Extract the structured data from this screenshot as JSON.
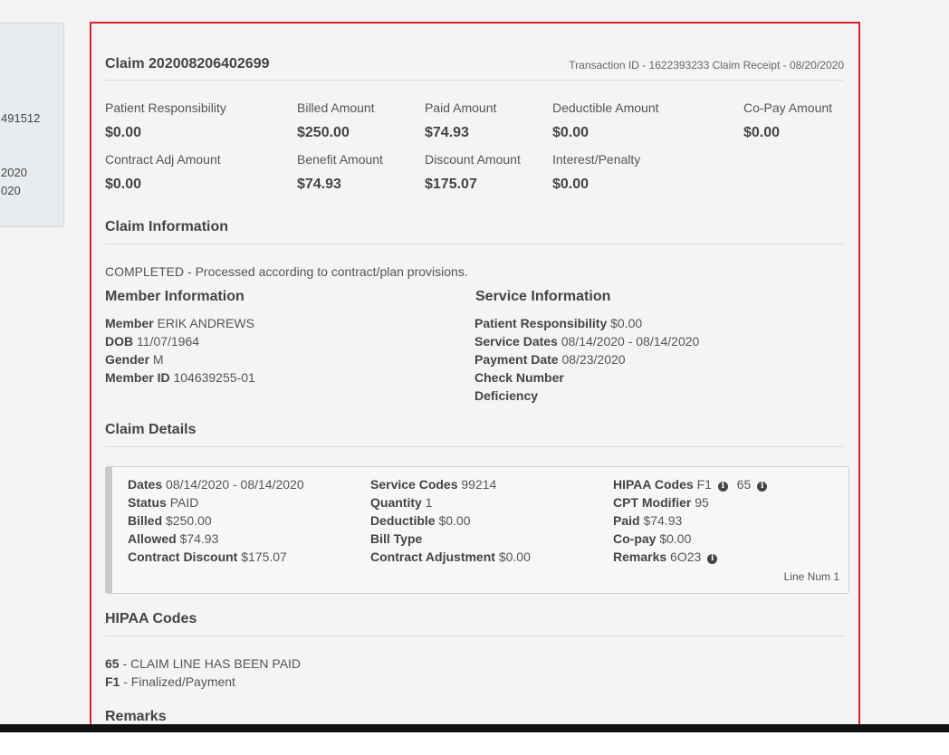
{
  "left_card": {
    "lines": [
      "491512",
      "2020",
      "020"
    ]
  },
  "claim": {
    "title": "Claim 202008206402699",
    "transaction": "Transaction ID - 1622393233 Claim Receipt - 08/20/2020"
  },
  "amounts": [
    {
      "label": "Patient Responsibility",
      "value": "$0.00"
    },
    {
      "label": "Billed Amount",
      "value": "$250.00"
    },
    {
      "label": "Paid Amount",
      "value": "$74.93"
    },
    {
      "label": "Deductible Amount",
      "value": "$0.00"
    },
    {
      "label": "Co-Pay Amount",
      "value": "$0.00"
    },
    {
      "label": "Contract Adj Amount",
      "value": "$0.00"
    },
    {
      "label": "Benefit Amount",
      "value": "$74.93"
    },
    {
      "label": "Discount Amount",
      "value": "$175.07"
    },
    {
      "label": "Interest/Penalty",
      "value": "$0.00"
    }
  ],
  "claim_information": {
    "heading": "Claim Information",
    "status_text": "COMPLETED - Processed according to contract/plan provisions."
  },
  "member": {
    "heading": "Member Information",
    "rows": [
      {
        "label": "Member",
        "value": "ERIK ANDREWS"
      },
      {
        "label": "DOB",
        "value": "11/07/1964"
      },
      {
        "label": "Gender",
        "value": "M"
      },
      {
        "label": "Member ID",
        "value": "104639255-01"
      }
    ]
  },
  "service": {
    "heading": "Service Information",
    "rows": [
      {
        "label": "Patient Responsibility",
        "value": "$0.00"
      },
      {
        "label": "Service Dates",
        "value": "08/14/2020 - 08/14/2020"
      },
      {
        "label": "Payment Date",
        "value": "08/23/2020"
      },
      {
        "label": "Check Number",
        "value": ""
      },
      {
        "label": "Deficiency",
        "value": ""
      }
    ]
  },
  "claim_details": {
    "heading": "Claim Details",
    "col1": [
      {
        "label": "Dates",
        "value": "08/14/2020 - 08/14/2020"
      },
      {
        "label": "Status",
        "value": "PAID"
      },
      {
        "label": "Billed",
        "value": "$250.00"
      },
      {
        "label": "Allowed",
        "value": "$74.93"
      },
      {
        "label": "Contract Discount",
        "value": "$175.07"
      }
    ],
    "col2": [
      {
        "label": "Service Codes",
        "value": "99214"
      },
      {
        "label": "Quantity",
        "value": "1"
      },
      {
        "label": "Deductible",
        "value": "$0.00"
      },
      {
        "label": "Bill Type",
        "value": ""
      },
      {
        "label": "Contract Adjustment",
        "value": "$0.00"
      }
    ],
    "col3": [
      {
        "label": "HIPAA Codes",
        "value": "F1",
        "extra": "65"
      },
      {
        "label": "CPT Modifier",
        "value": "95"
      },
      {
        "label": "Paid",
        "value": "$74.93"
      },
      {
        "label": "Co-pay",
        "value": "$0.00"
      },
      {
        "label": "Remarks",
        "value": "6O23"
      }
    ],
    "line_num": "Line Num 1",
    "info_icon_glyph": "i"
  },
  "hipaa": {
    "heading": "HIPAA Codes",
    "codes": [
      {
        "code": "65",
        "desc": "- CLAIM LINE HAS BEEN PAID"
      },
      {
        "code": "F1",
        "desc": "- Finalized/Payment"
      }
    ]
  },
  "remarks": {
    "heading": "Remarks"
  },
  "colors": {
    "highlight_border": "#d9232c",
    "background": "#f4f4f4"
  }
}
